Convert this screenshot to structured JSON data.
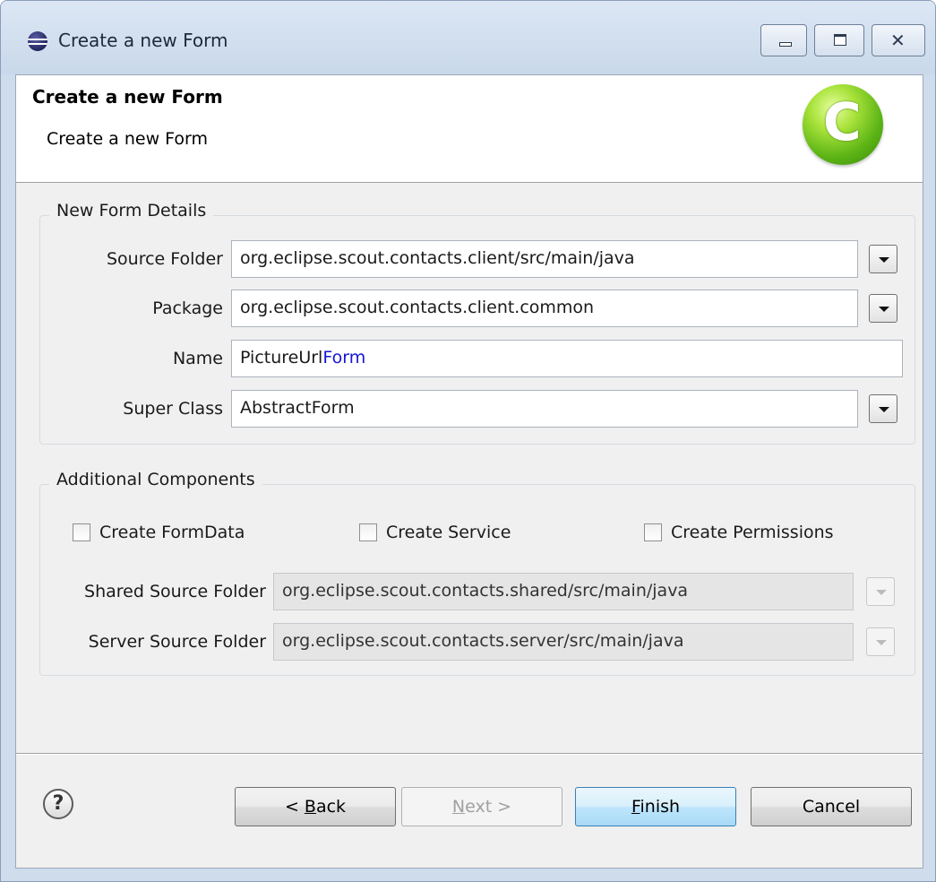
{
  "window": {
    "title": "Create a new Form"
  },
  "banner": {
    "title": "Create a new Form",
    "description": "Create a new Form",
    "logo_letter": "C"
  },
  "details": {
    "legend": "New Form Details",
    "source_folder": {
      "label": "Source Folder",
      "value": "org.eclipse.scout.contacts.client/src/main/java"
    },
    "package": {
      "label": "Package",
      "value": "org.eclipse.scout.contacts.client.common"
    },
    "name": {
      "label": "Name",
      "value_prefix": "PictureUrl",
      "value_suffix": "Form"
    },
    "super_class": {
      "label": "Super Class",
      "value": "AbstractForm"
    }
  },
  "additional": {
    "legend": "Additional Components",
    "checkboxes": [
      {
        "label": "Create FormData",
        "checked": false
      },
      {
        "label": "Create Service",
        "checked": false
      },
      {
        "label": "Create Permissions",
        "checked": false
      }
    ],
    "shared_source_folder": {
      "label": "Shared Source Folder",
      "value": "org.eclipse.scout.contacts.shared/src/main/java",
      "enabled": false
    },
    "server_source_folder": {
      "label": "Server Source Folder",
      "value": "org.eclipse.scout.contacts.server/src/main/java",
      "enabled": false
    }
  },
  "footer": {
    "help": "?",
    "back": {
      "mnemonic_prefix": "< ",
      "mnemonic": "B",
      "rest": "ack",
      "enabled": true
    },
    "next": {
      "mnemonic": "N",
      "rest": "ext >",
      "enabled": false
    },
    "finish": {
      "mnemonic": "F",
      "rest": "inish",
      "enabled": true,
      "default": true
    },
    "cancel": {
      "label": "Cancel",
      "enabled": true
    }
  }
}
